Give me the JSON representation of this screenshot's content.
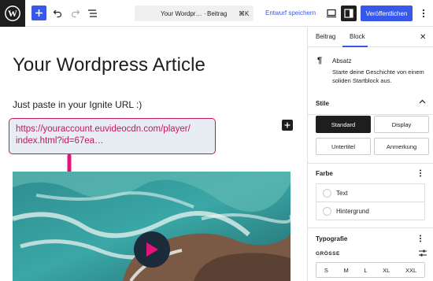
{
  "topbar": {
    "logo": "wordpress-logo",
    "doc_title": "Your Wordpr…",
    "doc_sep": "·",
    "doc_type": "Beitrag",
    "shortcut": "⌘K",
    "save_draft": "Entwurf speichern",
    "publish": "Veröffentlichen"
  },
  "editor": {
    "title": "Your Wordpress Article",
    "paragraph": "Just paste in your Ignite URL :)",
    "url_line1": "https://youraccount.euvideocdn.com/player/",
    "url_line2": "index.html?id=67ea…"
  },
  "sidebar": {
    "tab_post": "Beitrag",
    "tab_block": "Block",
    "block_name": "Absatz",
    "block_desc": "Starte deine Geschichte von einem soliden Startblock aus.",
    "styles_title": "Stile",
    "styles": [
      "Standard",
      "Display",
      "Untertitel",
      "Anmerkung"
    ],
    "color_title": "Farbe",
    "color_text": "Text",
    "color_bg": "Hintergrund",
    "typo_title": "Typografie",
    "size_label": "GRÖSSE",
    "sizes": [
      "S",
      "M",
      "L",
      "XL",
      "XXL"
    ]
  },
  "colors": {
    "accent": "#3858e9",
    "callout": "#c0185f",
    "dark": "#1e1e1e"
  }
}
